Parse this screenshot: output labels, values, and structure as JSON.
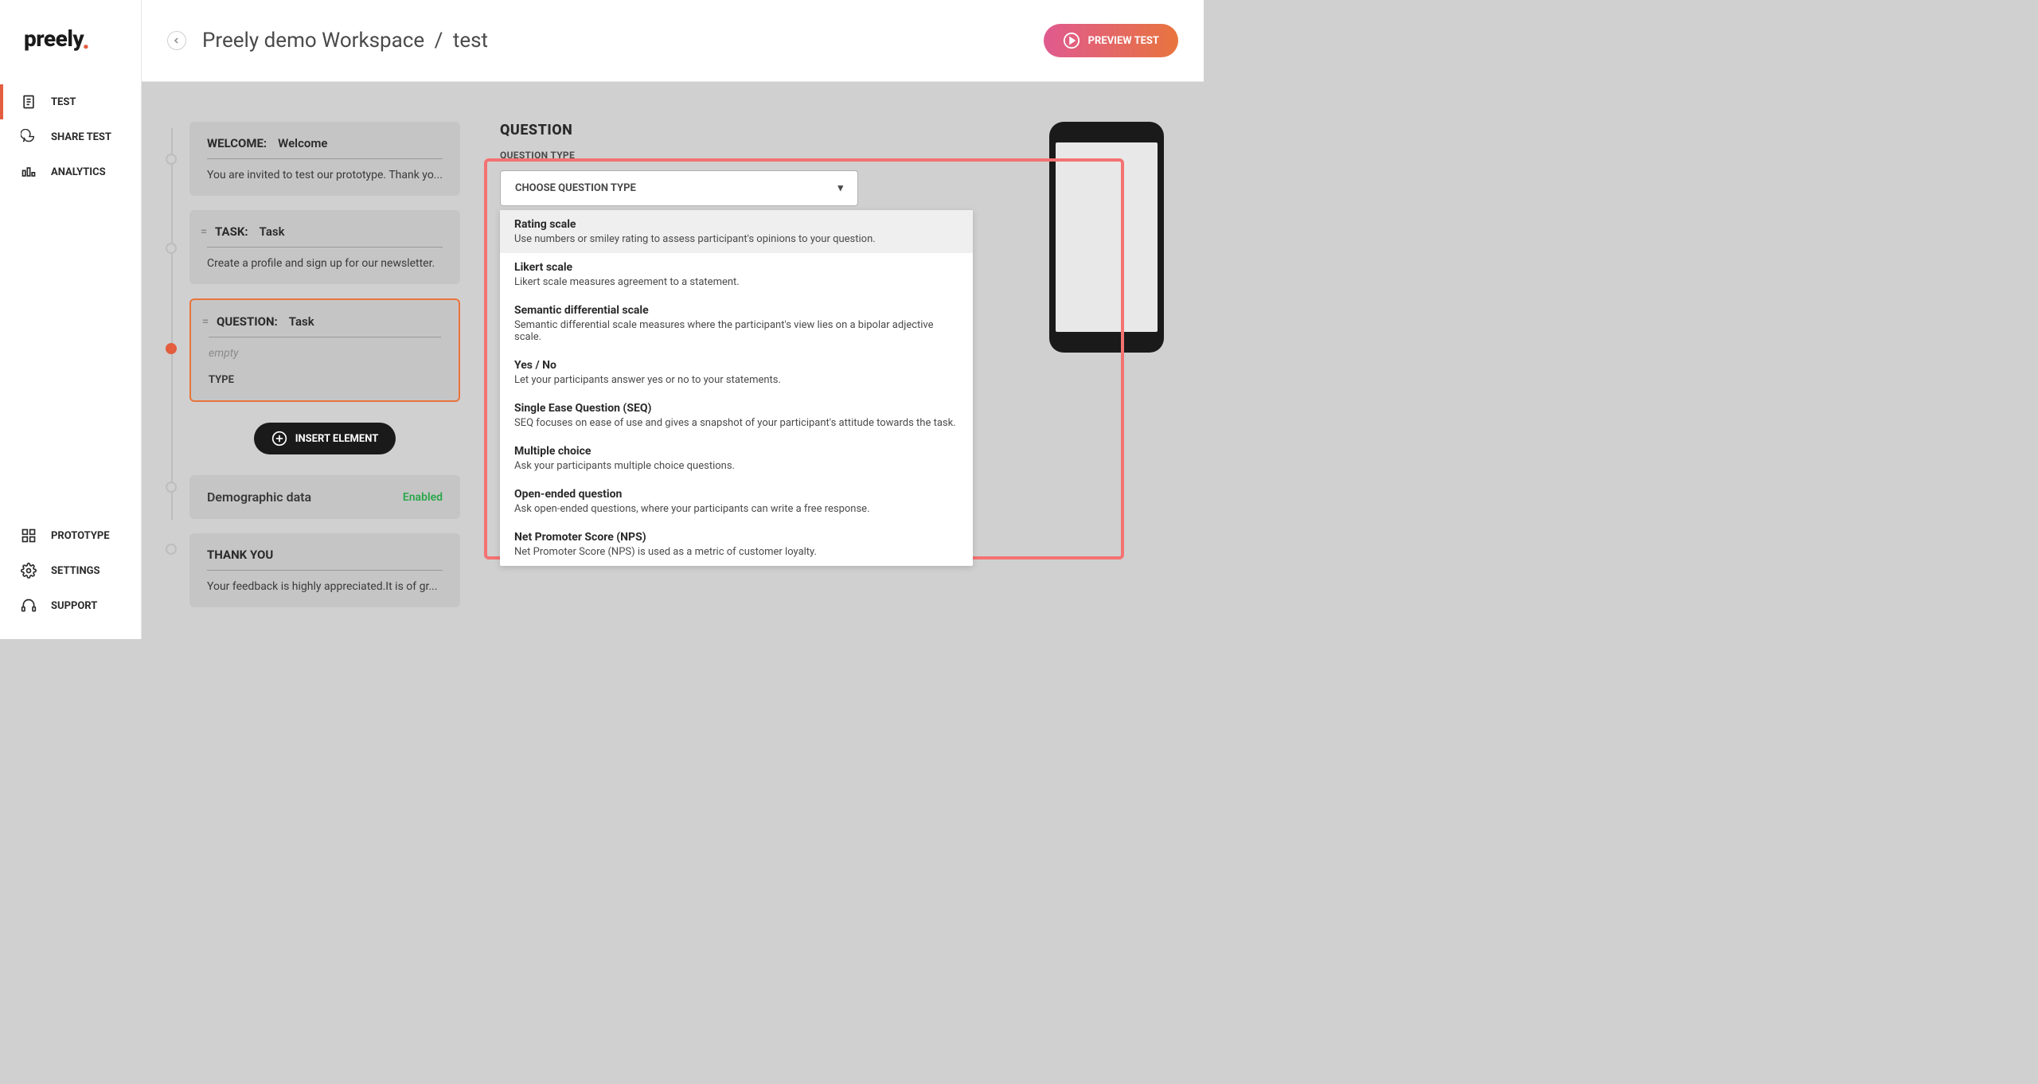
{
  "logo": "preely",
  "nav": {
    "top": [
      {
        "label": "TEST"
      },
      {
        "label": "SHARE TEST"
      },
      {
        "label": "ANALYTICS"
      }
    ],
    "bottom": [
      {
        "label": "PROTOTYPE"
      },
      {
        "label": "SETTINGS"
      },
      {
        "label": "SUPPORT"
      }
    ]
  },
  "breadcrumb": {
    "workspace": "Preely demo Workspace",
    "current": "test"
  },
  "preview_btn": "PREVIEW TEST",
  "timeline": {
    "welcome": {
      "label": "WELCOME:",
      "value": "Welcome",
      "body": "You are invited to test our prototype. Thank yo..."
    },
    "task": {
      "label": "TASK:",
      "value": "Task",
      "body": "Create a profile and sign up for our newsletter."
    },
    "question": {
      "label": "QUESTION:",
      "value": "Task",
      "body": "empty",
      "type_label": "TYPE"
    },
    "insert_btn": "INSERT ELEMENT",
    "demographic": {
      "title": "Demographic data",
      "status": "Enabled"
    },
    "thankyou": {
      "label": "THANK YOU",
      "body": "Your feedback is highly appreciated.It is of gr..."
    }
  },
  "question_panel": {
    "title": "QUESTION",
    "subtitle": "QUESTION TYPE",
    "dropdown_placeholder": "CHOOSE QUESTION TYPE",
    "options": [
      {
        "title": "Rating scale",
        "desc": "Use numbers or smiley rating to assess participant's opinions to your question."
      },
      {
        "title": "Likert scale",
        "desc": "Likert scale measures agreement to a statement."
      },
      {
        "title": "Semantic differential scale",
        "desc": "Semantic differential scale measures where the participant's view lies on a bipolar adjective scale."
      },
      {
        "title": "Yes / No",
        "desc": "Let your participants answer yes or no to your statements."
      },
      {
        "title": "Single Ease Question (SEQ)",
        "desc": "SEQ focuses on ease of use and gives a snapshot of your participant's attitude towards the task."
      },
      {
        "title": "Multiple choice",
        "desc": "Ask your participants multiple choice questions."
      },
      {
        "title": "Open-ended question",
        "desc": "Ask open-ended questions, where your participants can write a free response."
      },
      {
        "title": "Net Promoter Score (NPS)",
        "desc": "Net Promoter Score (NPS) is used as a metric of customer loyalty."
      }
    ]
  }
}
